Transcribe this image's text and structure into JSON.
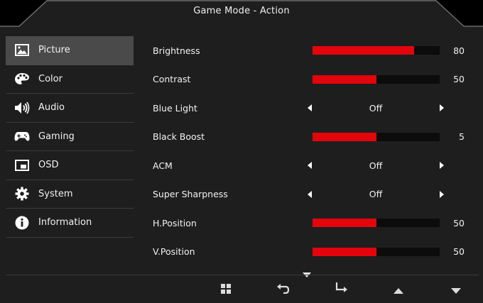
{
  "header": {
    "title": "Game Mode - Action"
  },
  "sidebar": {
    "items": [
      {
        "label": "Picture",
        "icon": "picture-icon",
        "active": true
      },
      {
        "label": "Color",
        "icon": "palette-icon"
      },
      {
        "label": "Audio",
        "icon": "speaker-icon"
      },
      {
        "label": "Gaming",
        "icon": "gamepad-icon"
      },
      {
        "label": "OSD",
        "icon": "osd-window-icon"
      },
      {
        "label": "System",
        "icon": "gear-icon"
      },
      {
        "label": "Information",
        "icon": "info-icon"
      }
    ]
  },
  "settings": {
    "rows": [
      {
        "label": "Brightness",
        "type": "slider",
        "value": "80",
        "level": 0.8
      },
      {
        "label": "Contrast",
        "type": "slider",
        "value": "50",
        "level": 0.5
      },
      {
        "label": "Blue Light",
        "type": "selector",
        "value": "Off"
      },
      {
        "label": "Black Boost",
        "type": "slider",
        "value": "5",
        "level": 0.5
      },
      {
        "label": "ACM",
        "type": "selector",
        "value": "Off"
      },
      {
        "label": "Super Sharpness",
        "type": "selector",
        "value": "Off"
      },
      {
        "label": "H.Position",
        "type": "slider",
        "value": "50",
        "level": 0.5
      },
      {
        "label": "V.Position",
        "type": "slider",
        "value": "50",
        "level": 0.5
      }
    ]
  },
  "footer": {
    "buttons": [
      "menu-grid-icon",
      "return-icon",
      "enter-icon",
      "up-arrow-icon",
      "down-arrow-icon"
    ]
  },
  "colors": {
    "accent": "#e3050b",
    "panel": "#1e1e1e",
    "active_item": "#4a4a4a",
    "frame": "#000000"
  }
}
